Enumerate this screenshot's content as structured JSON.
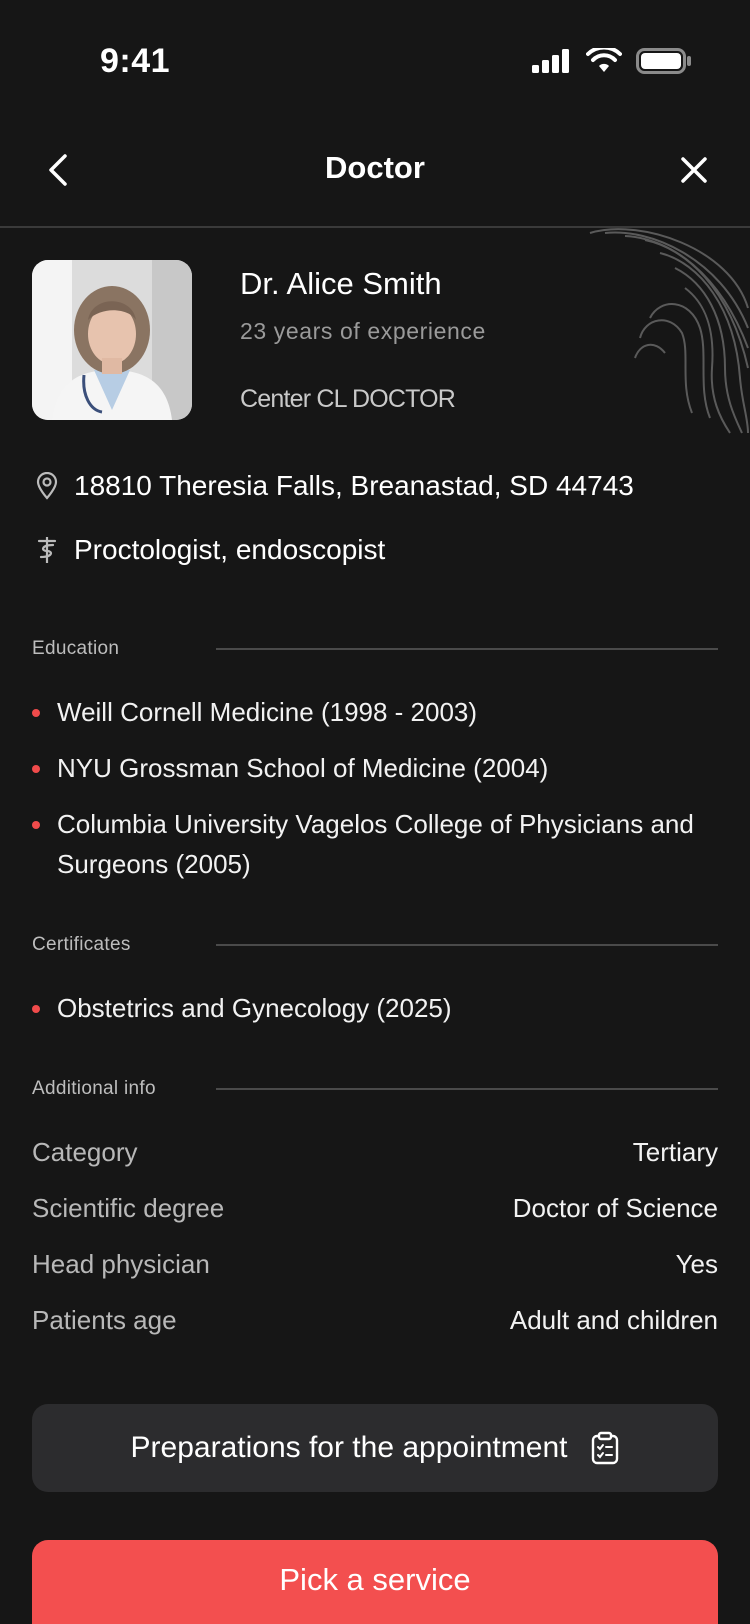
{
  "status_bar": {
    "time": "9:41"
  },
  "nav": {
    "title": "Doctor"
  },
  "doctor": {
    "name": "Dr. Alice Smith",
    "experience": "23 years of experience",
    "center": "Center CL DOCTOR",
    "address": "18810 Theresia Falls, Breanastad, SD 44743",
    "specialty": "Proctologist, endoscopist"
  },
  "education": {
    "title": "Education",
    "items": [
      "Weill Cornell Medicine (1998 - 2003)",
      "NYU Grossman School of Medicine (2004)",
      "Columbia University Vagelos College of Physicians and Surgeons (2005)"
    ]
  },
  "certificates": {
    "title": "Certificates",
    "items": [
      "Obstetrics and Gynecology (2025)"
    ]
  },
  "additional": {
    "title": "Additional info",
    "rows": [
      {
        "key": "Category",
        "value": "Tertiary"
      },
      {
        "key": "Scientific degree",
        "value": "Doctor of Science"
      },
      {
        "key": "Head physician",
        "value": "Yes"
      },
      {
        "key": "Patients age",
        "value": "Adult and children"
      }
    ]
  },
  "buttons": {
    "preparations": "Preparations for the appointment",
    "pick_service": "Pick a service"
  },
  "colors": {
    "background": "#161616",
    "accent": "#f34f4f",
    "secondary_button": "#2c2c2e"
  }
}
